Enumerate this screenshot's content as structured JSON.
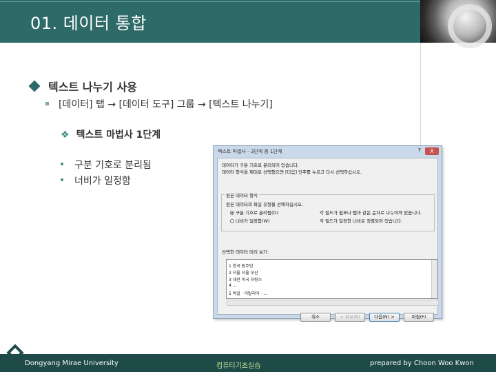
{
  "header": {
    "title": "01. 데이터 통합"
  },
  "bullets": {
    "level1": "텍스트 나누기 사용",
    "level2": "[데이터] 탭 → [데이터 도구] 그룹 → [텍스트 나누기]",
    "level3": "텍스트 마법사 1단계",
    "level4": [
      "구분 기호로 분리됨",
      "너비가 일정함"
    ]
  },
  "dialog": {
    "title": "텍스트 마법사 - 3단계 중 1단계",
    "help": "?",
    "close": "X",
    "line1": "데이터가 구분 기호로 분리되어 있습니다.",
    "line2": "데이터 형식을 제대로 선택했으면 [다음] 단추를 누르고 다시 선택하십시오.",
    "group_label": "원본 데이터 형식",
    "group_prompt": "원본 데이터의 파일 유형을 선택하십시오.",
    "option1_label": "구분 기호로 분리됨(D)",
    "option1_desc": "각 필드가 쉼표나 탭과 같은 문자로 나누어져 있습니다.",
    "option2_label": "너비가 일정함(W)",
    "option2_desc": "각 필드가 일정한 너비로 정렬되어 있습니다.",
    "preview_label": "선택한 데이터 미리 보기:",
    "preview_rows": [
      "1 한국 원주민",
      "2 서울 서울 부산",
      "3 대전 미국 프랑스",
      "4 ...",
      "5 독일 · 이탈리아 · ..."
    ],
    "buttons": {
      "cancel": "취소",
      "back": "< 뒤로(B)",
      "next": "다음(N) >",
      "finish": "마침(F)"
    }
  },
  "footer": {
    "left": "Dongyang Mirae University",
    "center": "컴퓨터기초실습",
    "right": "prepared by Choon Woo Kwon"
  },
  "colors": {
    "header_bg": "#2e6b68",
    "footer_bg": "#1e4a47",
    "accent": "#3f8a84"
  }
}
